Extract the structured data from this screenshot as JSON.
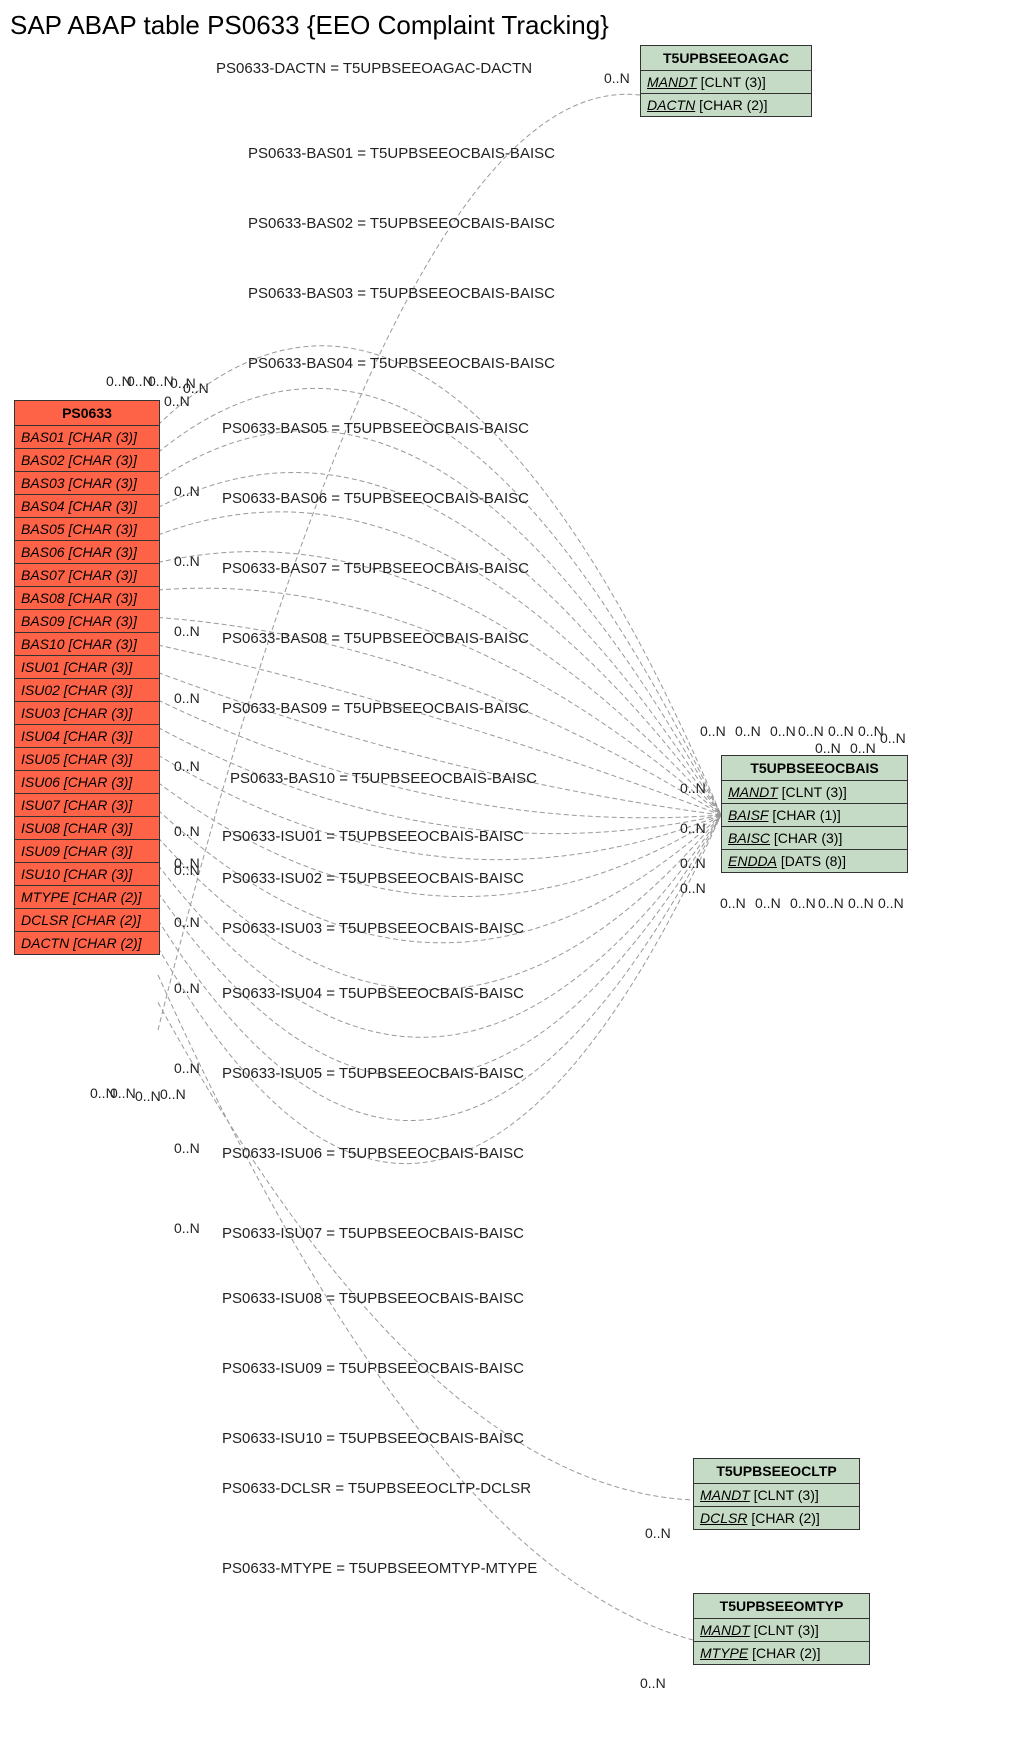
{
  "title": "SAP ABAP table PS0633 {EEO Complaint Tracking}",
  "ps0633": {
    "name": "PS0633",
    "rows": [
      "BAS01 [CHAR (3)]",
      "BAS02 [CHAR (3)]",
      "BAS03 [CHAR (3)]",
      "BAS04 [CHAR (3)]",
      "BAS05 [CHAR (3)]",
      "BAS06 [CHAR (3)]",
      "BAS07 [CHAR (3)]",
      "BAS08 [CHAR (3)]",
      "BAS09 [CHAR (3)]",
      "BAS10 [CHAR (3)]",
      "ISU01 [CHAR (3)]",
      "ISU02 [CHAR (3)]",
      "ISU03 [CHAR (3)]",
      "ISU04 [CHAR (3)]",
      "ISU05 [CHAR (3)]",
      "ISU06 [CHAR (3)]",
      "ISU07 [CHAR (3)]",
      "ISU08 [CHAR (3)]",
      "ISU09 [CHAR (3)]",
      "ISU10 [CHAR (3)]",
      "MTYPE [CHAR (2)]",
      "DCLSR [CHAR (2)]",
      "DACTN [CHAR (2)]"
    ]
  },
  "t_agac": {
    "name": "T5UPBSEEOAGAC",
    "rows": [
      {
        "key": "MANDT",
        "rest": " [CLNT (3)]"
      },
      {
        "key": "DACTN",
        "rest": " [CHAR (2)]"
      }
    ]
  },
  "t_cbais": {
    "name": "T5UPBSEEOCBAIS",
    "rows": [
      {
        "key": "MANDT",
        "rest": " [CLNT (3)]"
      },
      {
        "key": "BAISF",
        "rest": " [CHAR (1)]"
      },
      {
        "key": "BAISC",
        "rest": " [CHAR (3)]"
      },
      {
        "key": "ENDDA",
        "rest": " [DATS (8)]"
      }
    ]
  },
  "t_cltp": {
    "name": "T5UPBSEEOCLTP",
    "rows": [
      {
        "key": "MANDT",
        "rest": " [CLNT (3)]"
      },
      {
        "key": "DCLSR",
        "rest": " [CHAR (2)]"
      }
    ]
  },
  "t_mtyp": {
    "name": "T5UPBSEEOMTYP",
    "rows": [
      {
        "key": "MANDT",
        "rest": " [CLNT (3)]"
      },
      {
        "key": "MTYPE",
        "rest": " [CHAR (2)]"
      }
    ]
  },
  "relations": [
    "PS0633-DACTN = T5UPBSEEOAGAC-DACTN",
    "PS0633-BAS01 = T5UPBSEEOCBAIS-BAISC",
    "PS0633-BAS02 = T5UPBSEEOCBAIS-BAISC",
    "PS0633-BAS03 = T5UPBSEEOCBAIS-BAISC",
    "PS0633-BAS04 = T5UPBSEEOCBAIS-BAISC",
    "PS0633-BAS05 = T5UPBSEEOCBAIS-BAISC",
    "PS0633-BAS06 = T5UPBSEEOCBAIS-BAISC",
    "PS0633-BAS07 = T5UPBSEEOCBAIS-BAISC",
    "PS0633-BAS08 = T5UPBSEEOCBAIS-BAISC",
    "PS0633-BAS09 = T5UPBSEEOCBAIS-BAISC",
    "PS0633-BAS10 = T5UPBSEEOCBAIS-BAISC",
    "PS0633-ISU01 = T5UPBSEEOCBAIS-BAISC",
    "PS0633-ISU02 = T5UPBSEEOCBAIS-BAISC",
    "PS0633-ISU03 = T5UPBSEEOCBAIS-BAISC",
    "PS0633-ISU04 = T5UPBSEEOCBAIS-BAISC",
    "PS0633-ISU05 = T5UPBSEEOCBAIS-BAISC",
    "PS0633-ISU06 = T5UPBSEEOCBAIS-BAISC",
    "PS0633-ISU07 = T5UPBSEEOCBAIS-BAISC",
    "PS0633-ISU08 = T5UPBSEEOCBAIS-BAISC",
    "PS0633-ISU09 = T5UPBSEEOCBAIS-BAISC",
    "PS0633-ISU10 = T5UPBSEEOCBAIS-BAISC",
    "PS0633-DCLSR = T5UPBSEEOCLTP-DCLSR",
    "PS0633-MTYPE = T5UPBSEEOMTYP-MTYPE"
  ],
  "cards_left": [
    "0..N",
    "0..N",
    "0..N",
    "0..N",
    "0..N",
    "0..N",
    "0..N",
    "0..N",
    "0..N",
    "0..N",
    "0..N",
    "0..N",
    "0..N",
    "0..N",
    "0..N",
    "0..N",
    "0..N",
    "0..N",
    "0..N",
    "0..N",
    "0..N",
    "0..N",
    "0..N"
  ],
  "cards_right": [
    "0..N",
    "0..N",
    "0..N",
    "0..N",
    "0..N",
    "0..N",
    "0..N",
    "0..N",
    "0..N",
    "0..N",
    "0..N",
    "0..N",
    "0..N",
    "0..N",
    "0..N",
    "0..N",
    "0..N",
    "0..N",
    "0..N",
    "0..N",
    "0..N",
    "0..N",
    "0..N"
  ]
}
